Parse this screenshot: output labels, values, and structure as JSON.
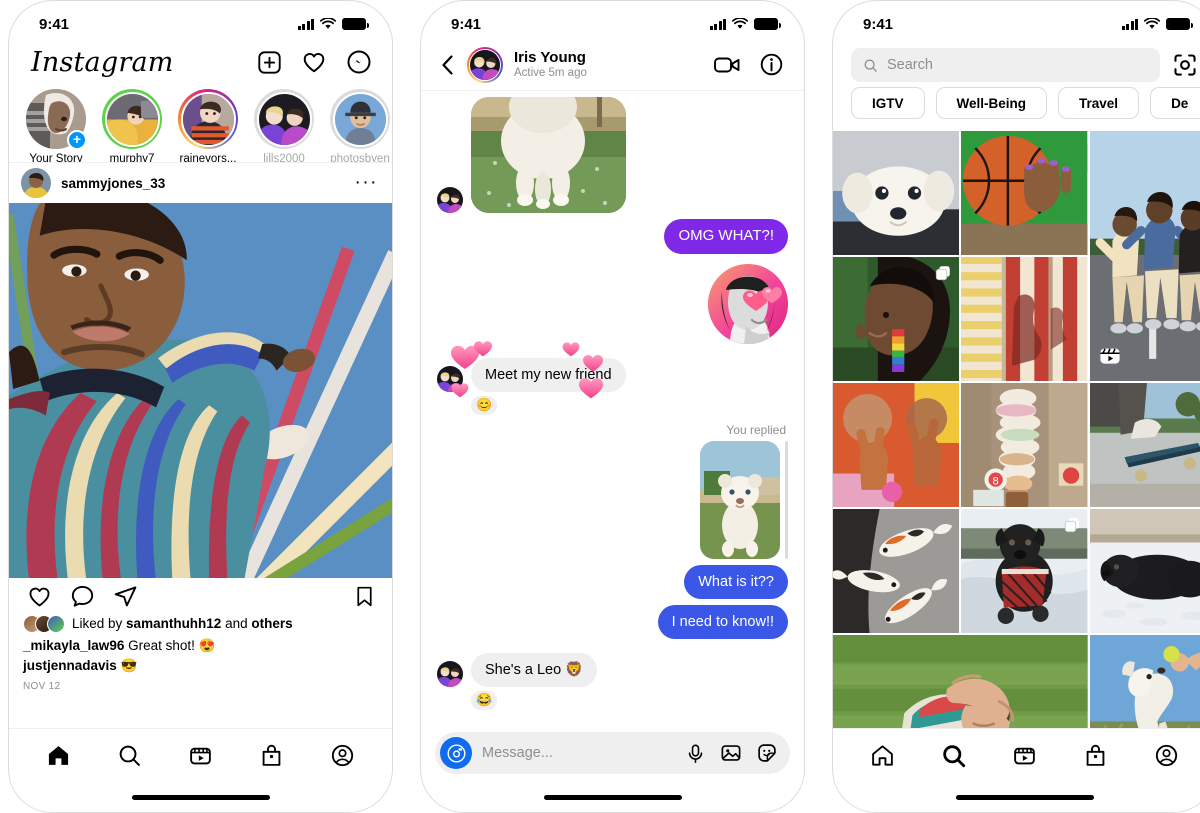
{
  "status_bar": {
    "time": "9:41",
    "signal_icon": "cellular-bars-icon",
    "wifi_icon": "wifi-icon",
    "battery_icon": "battery-icon"
  },
  "feed_screen": {
    "app_title": "Instagram",
    "header_icons": [
      {
        "name": "new-post-icon",
        "label": "New Post"
      },
      {
        "name": "activity-heart-icon",
        "label": "Activity"
      },
      {
        "name": "messenger-icon",
        "label": "Messenger"
      }
    ],
    "stories": [
      {
        "username": "Your Story",
        "ring": "none",
        "seen": false,
        "has_add_badge": true
      },
      {
        "username": "murphy7",
        "ring": "green",
        "seen": false,
        "has_add_badge": false
      },
      {
        "username": "raineyors...",
        "ring": "gradient",
        "seen": false,
        "has_add_badge": false
      },
      {
        "username": "lills2000",
        "ring": "grey",
        "seen": true,
        "has_add_badge": false
      },
      {
        "username": "photosbyen",
        "ring": "grey",
        "seen": true,
        "has_add_badge": false
      }
    ],
    "post": {
      "username": "sammyjones_33",
      "more_options": "···",
      "actions": [
        {
          "name": "like-icon",
          "label": "Like"
        },
        {
          "name": "comment-icon",
          "label": "Comment"
        },
        {
          "name": "share-icon",
          "label": "Share"
        },
        {
          "name": "save-bookmark-icon",
          "label": "Save"
        }
      ],
      "liked_by_prefix": "Liked by ",
      "liked_by_user": "samanthuhh12",
      "liked_by_middle": " and ",
      "liked_by_others": "others",
      "comments": [
        {
          "user": "_mikayla_law96",
          "text": " Great shot! 😍"
        },
        {
          "user": "justjennadavis",
          "text": " 😎"
        }
      ],
      "date": "NOV 12"
    },
    "tabbar": [
      {
        "name": "tab-home",
        "icon": "home-icon",
        "active": true
      },
      {
        "name": "tab-search",
        "icon": "search-icon",
        "active": false
      },
      {
        "name": "tab-reels",
        "icon": "reels-icon",
        "active": false
      },
      {
        "name": "tab-shop",
        "icon": "shop-bag-icon",
        "active": false
      },
      {
        "name": "tab-profile",
        "icon": "profile-circle-icon",
        "active": false
      }
    ]
  },
  "dm_screen": {
    "back_icon": "chevron-left-icon",
    "contact_name": "Iris Young",
    "contact_status": "Active 5m ago",
    "header_icons": [
      {
        "name": "video-call-icon",
        "label": "Video call"
      },
      {
        "name": "info-icon",
        "label": "Details"
      }
    ],
    "messages": [
      {
        "id": "m1",
        "sender": "them",
        "type": "photo",
        "alt": "white puppy walking on grass"
      },
      {
        "id": "m2",
        "sender": "me",
        "type": "text",
        "text": "OMG WHAT?!",
        "style": "purple"
      },
      {
        "id": "m3",
        "sender": "me",
        "type": "avatar",
        "alt": "profile photo with heart-eyes filter"
      },
      {
        "id": "m4",
        "sender": "them",
        "type": "text",
        "text": "Meet my new friend",
        "reaction": "😊",
        "hearts": true
      },
      {
        "id": "m5",
        "sender": "me",
        "type": "reply-photo",
        "label": "You replied",
        "alt": "white lion cub"
      },
      {
        "id": "m6",
        "sender": "me",
        "type": "text",
        "text": "What is it??",
        "style": "blue"
      },
      {
        "id": "m7",
        "sender": "me",
        "type": "text",
        "text": "I need to know!!",
        "style": "blue"
      },
      {
        "id": "m8",
        "sender": "them",
        "type": "text",
        "text": "She's a Leo 🦁",
        "reaction": "😂"
      }
    ],
    "composer": {
      "camera_icon": "camera-icon",
      "placeholder": "Message...",
      "icons": [
        {
          "name": "microphone-icon",
          "label": "Voice message"
        },
        {
          "name": "gallery-image-icon",
          "label": "Photo"
        },
        {
          "name": "sticker-icon",
          "label": "Sticker"
        }
      ]
    }
  },
  "explore_screen": {
    "search_placeholder": "Search",
    "search_icon": "search-icon",
    "scan_icon": "scan-code-icon",
    "chips": [
      {
        "label": "IGTV"
      },
      {
        "label": "Well-Being"
      },
      {
        "label": "Travel"
      },
      {
        "label": "De"
      }
    ],
    "grid": [
      {
        "id": "g1",
        "alt": "white fluffy dog lying down",
        "size": "normal",
        "badge": ""
      },
      {
        "id": "g2",
        "alt": "hands holding a basketball, green sleeve",
        "size": "normal",
        "badge": ""
      },
      {
        "id": "g3",
        "alt": "three skateboarders on a road",
        "size": "tall",
        "badge": "reels"
      },
      {
        "id": "g4",
        "alt": "woman profile with rainbow earring",
        "size": "normal",
        "badge": "carousel"
      },
      {
        "id": "g5",
        "alt": "red and yellow striped wall with shadow",
        "size": "normal",
        "badge": ""
      },
      {
        "id": "g6",
        "alt": "people making peace signs",
        "size": "normal",
        "badge": ""
      },
      {
        "id": "g7",
        "alt": "tall stacked ice cream cone",
        "size": "normal",
        "badge": ""
      },
      {
        "id": "g8",
        "alt": "skateboard tipping on pavement",
        "size": "normal",
        "badge": ""
      },
      {
        "id": "g9",
        "alt": "koi fish painted on pavement",
        "size": "normal",
        "badge": ""
      },
      {
        "id": "g10",
        "alt": "black dog in plaid coat in snow",
        "size": "normal",
        "badge": "carousel"
      },
      {
        "id": "g11",
        "alt": "black curly dog lying in snow",
        "size": "normal",
        "badge": ""
      },
      {
        "id": "g12",
        "alt": "person lying on green grass",
        "size": "wide",
        "badge": ""
      },
      {
        "id": "g13",
        "alt": "white dog jumping for a tennis ball",
        "size": "normal",
        "badge": ""
      }
    ],
    "tabbar": [
      {
        "name": "tab-home",
        "icon": "home-icon",
        "active": false
      },
      {
        "name": "tab-search",
        "icon": "search-icon",
        "active": true
      },
      {
        "name": "tab-reels",
        "icon": "reels-icon",
        "active": false
      },
      {
        "name": "tab-shop",
        "icon": "shop-bag-icon",
        "active": false
      },
      {
        "name": "tab-profile",
        "icon": "profile-circle-icon",
        "active": false
      }
    ]
  },
  "colors": {
    "ig_blue": "#0095F6",
    "dm_blue": "#3A57E8",
    "dm_purple": "#8028E8",
    "bubble_grey": "#efefef",
    "muted_text": "#8e8e8e",
    "close_friends_green": "#5ED24B"
  }
}
